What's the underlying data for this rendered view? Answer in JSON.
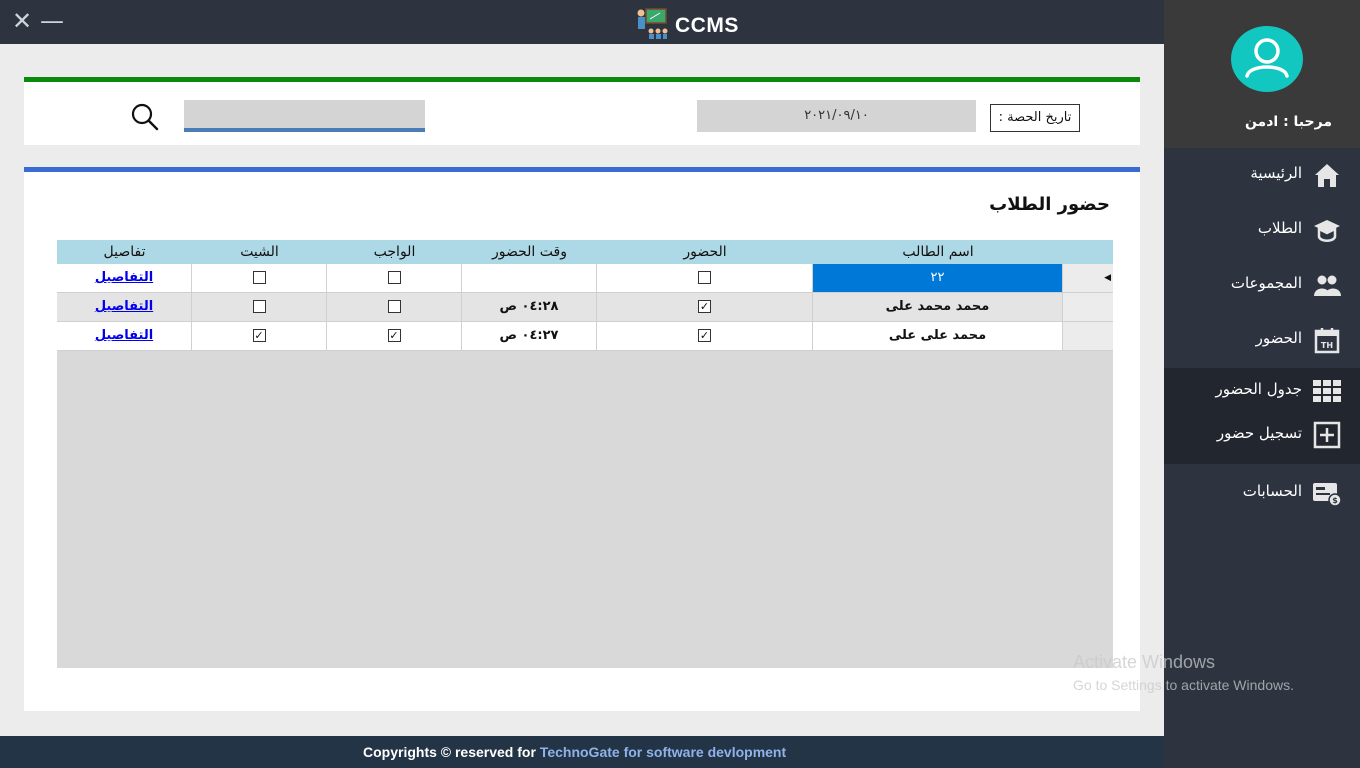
{
  "window": {
    "title": "CCMS",
    "close_glyph": "✕",
    "minimize_glyph": "—"
  },
  "filter": {
    "date_label": "تاريخ الحصة :",
    "date_value": "٢٠٢١/٠٩/١٠",
    "search_value": "",
    "search_icon": "search-icon"
  },
  "section_title": "حضور الطلاب",
  "table": {
    "headers": {
      "student_name": "اسم الطالب",
      "attendance": "الحضور",
      "time": "وقت الحضور",
      "homework": "الواجب",
      "sheet": "الشيت",
      "details": "تفاصيل"
    },
    "rows": [
      {
        "student_name": "٢٢",
        "attendance": false,
        "time": "",
        "homework": false,
        "sheet": false,
        "details": "التفاصيل",
        "selected": true
      },
      {
        "student_name": "محمد محمد على",
        "attendance": true,
        "time": "٠٤:٢٨ ص",
        "homework": false,
        "sheet": false,
        "details": "التفاصيل",
        "selected": false
      },
      {
        "student_name": "محمد على على",
        "attendance": true,
        "time": "٠٤:٢٧ ص",
        "homework": true,
        "sheet": true,
        "details": "التفاصيل",
        "selected": false
      }
    ]
  },
  "sidebar": {
    "greeting": "مرحبا :   ادمن",
    "items": [
      {
        "label": "الرئيسية",
        "icon": "home-icon"
      },
      {
        "label": "الطلاب",
        "icon": "graduation-cap-icon"
      },
      {
        "label": "المجموعات",
        "icon": "group-icon"
      },
      {
        "label": "الحضور",
        "icon": "calendar-icon"
      },
      {
        "label": "جدول الحضور",
        "icon": "grid-icon"
      },
      {
        "label": "تسجيل حضور",
        "icon": "plus-square-icon"
      },
      {
        "label": "الحسابات",
        "icon": "billing-icon"
      }
    ]
  },
  "footer": {
    "prefix": "Copyrights ©  reserved for",
    "company": " TechnoGate for software devlopment"
  },
  "watermark": {
    "line1": "Activate Windows",
    "line2": "Go to Settings to activate Windows."
  },
  "colors": {
    "accent_green": "#0a8a0a",
    "accent_blue": "#3a6ad4",
    "header_bg": "#add8e6",
    "selected_row": "#0078d7",
    "avatar": "#12c7c0"
  }
}
